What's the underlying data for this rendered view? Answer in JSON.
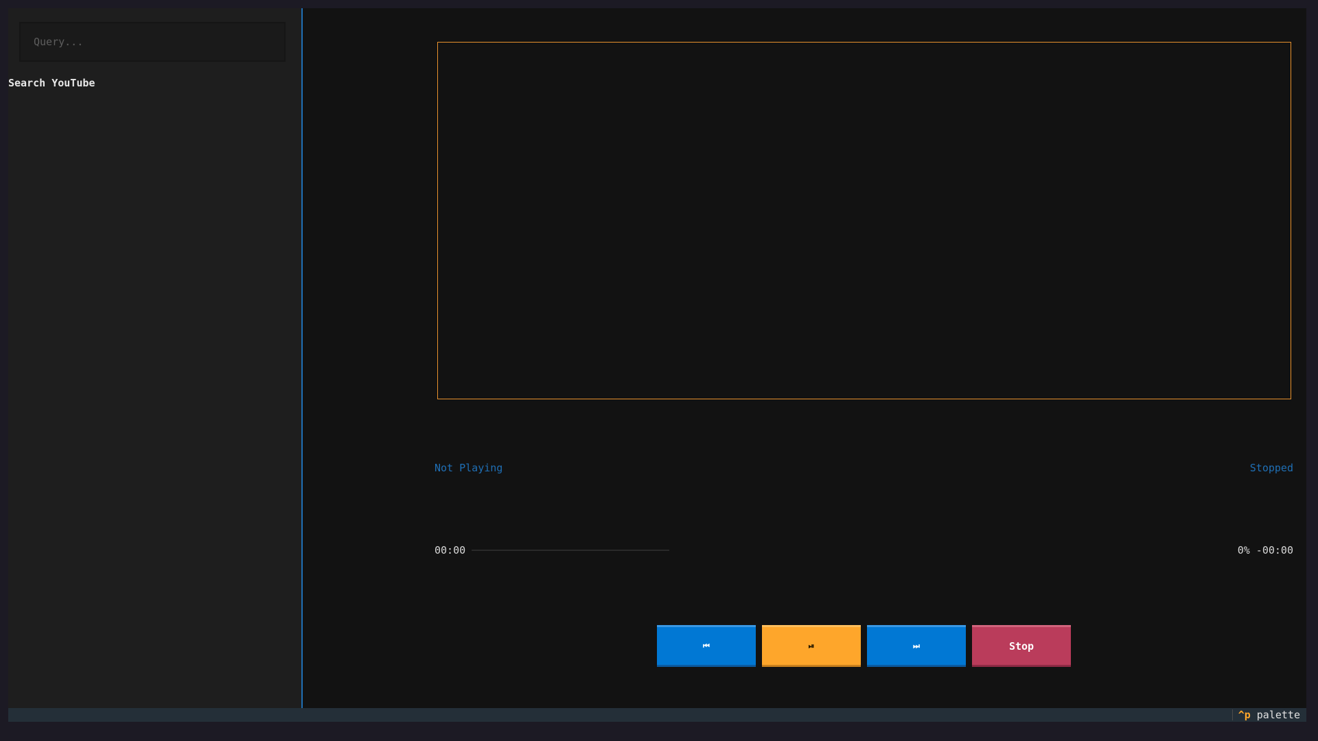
{
  "sidebar": {
    "search": {
      "placeholder": "Query...",
      "value": ""
    },
    "search_label": "Search YouTube"
  },
  "player": {
    "now_playing": "Not Playing",
    "state": "Stopped",
    "time_elapsed": "00:00",
    "progress_percent": 0,
    "time_remaining": "0% -00:00"
  },
  "controls": {
    "previous_icon": "⏮",
    "play_pause_icon": "⏯",
    "next_icon": "⏭",
    "stop_label": "Stop"
  },
  "footer": {
    "key": "^p",
    "label": "palette"
  },
  "colors": {
    "accent_blue": "#0178d4",
    "accent_orange": "#fea62b",
    "accent_red": "#ba3c5b",
    "background": "#121212"
  }
}
